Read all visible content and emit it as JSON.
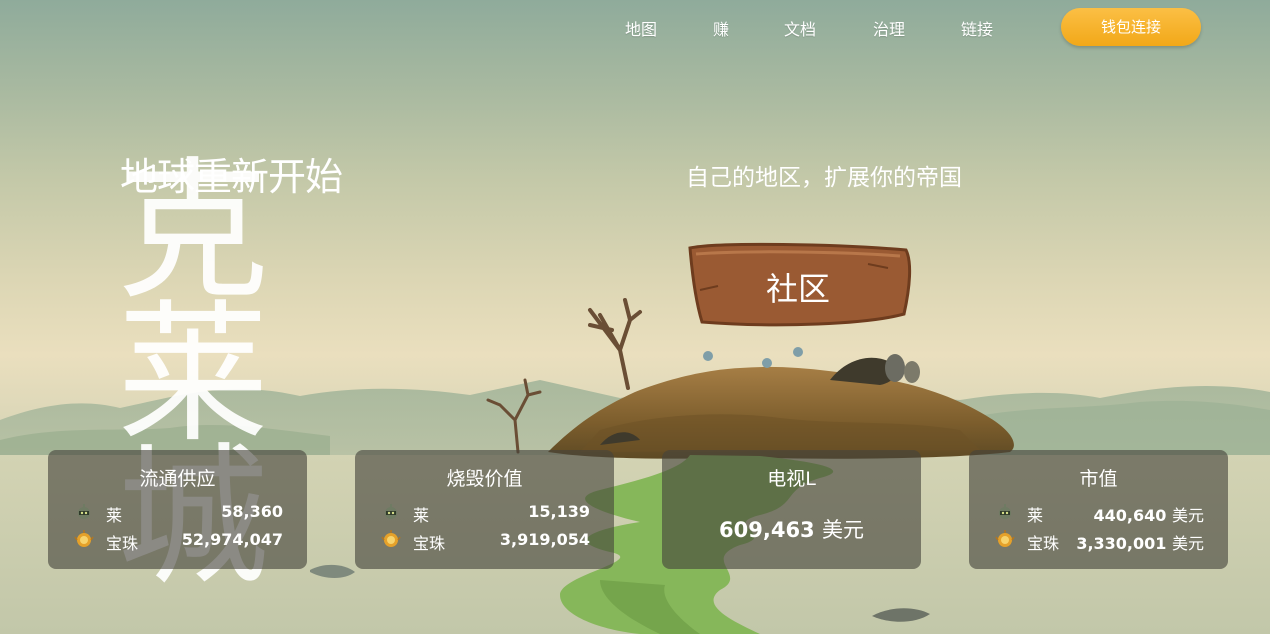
{
  "nav": {
    "items": [
      "地图",
      "赚",
      "文档",
      "治理",
      "链接"
    ],
    "wallet_button": "钱包连接"
  },
  "hero": {
    "subtitle": "地球重新开始",
    "title": "克莱城",
    "tagline": "自己的地区，扩展你的帝国",
    "community_button": "社区"
  },
  "stats": {
    "circulating": {
      "title": "流通供应",
      "rows": [
        {
          "name": "莱",
          "icon": "robot-token-icon",
          "value": "58,360"
        },
        {
          "name": "宝珠",
          "icon": "orb-token-icon",
          "value": "52,974,047"
        }
      ]
    },
    "burned": {
      "title": "烧毁价值",
      "rows": [
        {
          "name": "莱",
          "icon": "robot-token-icon",
          "value": "15,139"
        },
        {
          "name": "宝珠",
          "icon": "orb-token-icon",
          "value": "3,919,054"
        }
      ]
    },
    "tvl": {
      "title": "电视L",
      "value": "609,463",
      "unit": "美元"
    },
    "market_cap": {
      "title": "市值",
      "rows": [
        {
          "name": "莱",
          "icon": "robot-token-icon",
          "value": "440,640",
          "unit": "美元"
        },
        {
          "name": "宝珠",
          "icon": "orb-token-icon",
          "value": "3,330,001",
          "unit": "美元"
        }
      ]
    }
  },
  "colors": {
    "accent": "#f5b12a",
    "card_bg": "#46443c",
    "button_wood": "#9a5a33",
    "sky_top": "#8fab9b",
    "sky_horizon": "#eadfbe",
    "water_green": "#86b75a"
  }
}
